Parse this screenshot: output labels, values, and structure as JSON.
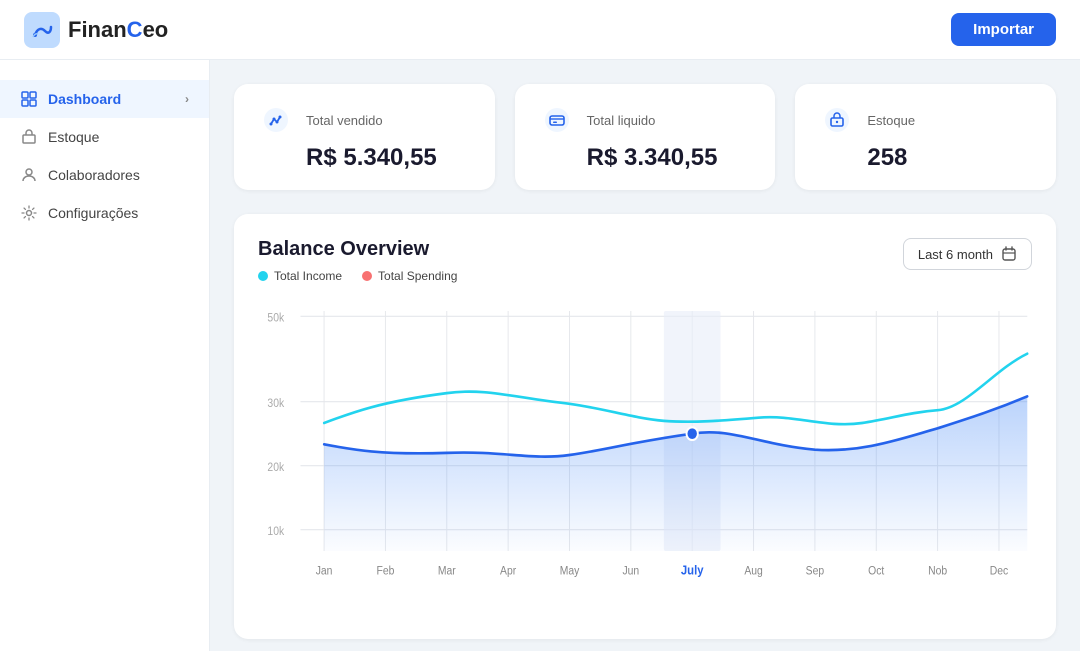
{
  "app": {
    "name_part1": "Finan",
    "name_part2": "C",
    "name_part3": "eo"
  },
  "topbar": {
    "import_label": "Importar"
  },
  "sidebar": {
    "items": [
      {
        "id": "dashboard",
        "label": "Dashboard",
        "active": true,
        "has_chevron": true
      },
      {
        "id": "estoque",
        "label": "Estoque",
        "active": false,
        "has_chevron": false
      },
      {
        "id": "colaboradores",
        "label": "Colaboradores",
        "active": false,
        "has_chevron": false
      },
      {
        "id": "configuracoes",
        "label": "Configurações",
        "active": false,
        "has_chevron": false
      }
    ]
  },
  "summary_cards": [
    {
      "id": "total-vendido",
      "title": "Total vendido",
      "value": "R$ 5.340,55",
      "icon": "💰"
    },
    {
      "id": "total-liquido",
      "title": "Total liquido",
      "value": "R$ 3.340,55",
      "icon": "💳"
    },
    {
      "id": "estoque",
      "title": "Estoque",
      "value": "258",
      "icon": "📦"
    }
  ],
  "chart": {
    "title": "Balance Overview",
    "period_label": "Last 6 month",
    "legend": [
      {
        "label": "Total Income",
        "color": "#22d3ee"
      },
      {
        "label": "Total Spending",
        "color": "#f87171"
      }
    ],
    "y_labels": [
      "50k",
      "30k",
      "20k",
      "10k"
    ],
    "x_labels": [
      "Jan",
      "Feb",
      "Mar",
      "Apr",
      "May",
      "Jun",
      "July",
      "Aug",
      "Sep",
      "Oct",
      "Nob",
      "Dec"
    ],
    "highlighted_x": "July"
  }
}
